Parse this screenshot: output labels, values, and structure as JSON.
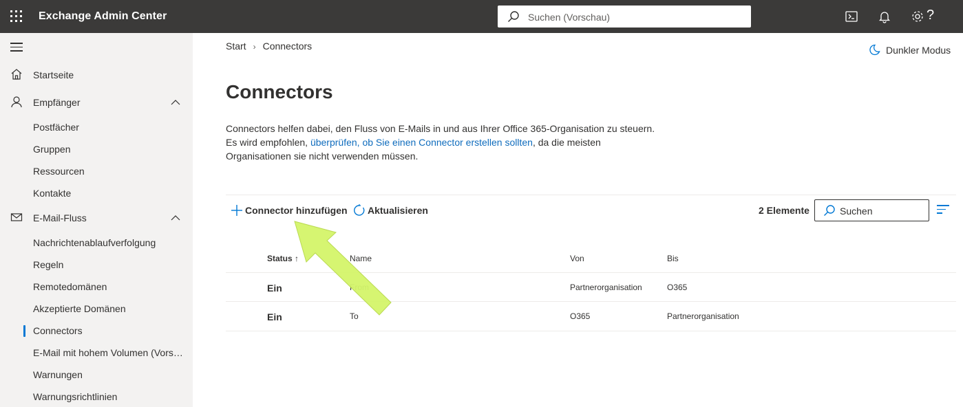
{
  "header": {
    "app_title": "Exchange Admin Center",
    "search_placeholder": "Suchen (Vorschau)",
    "help_label": "?"
  },
  "sidebar": {
    "items": [
      {
        "label": "Startseite",
        "icon": "home-icon"
      },
      {
        "label": "Empfänger",
        "icon": "person-icon",
        "expanded": true
      },
      {
        "label": "Postfächer"
      },
      {
        "label": "Gruppen"
      },
      {
        "label": "Ressourcen"
      },
      {
        "label": "Kontakte"
      },
      {
        "label": "E-Mail-Fluss",
        "icon": "mail-icon",
        "expanded": true
      },
      {
        "label": "Nachrichtenablaufverfolgung"
      },
      {
        "label": "Regeln"
      },
      {
        "label": "Remotedomänen"
      },
      {
        "label": "Akzeptierte Domänen"
      },
      {
        "label": "Connectors",
        "active": true
      },
      {
        "label": "E-Mail mit hohem Volumen (Vorschau)"
      },
      {
        "label": "Warnungen"
      },
      {
        "label": "Warnungsrichtlinien"
      }
    ]
  },
  "breadcrumb": {
    "home": "Start",
    "current": "Connectors"
  },
  "dark_mode_label": "Dunkler Modus",
  "page": {
    "title": "Connectors",
    "desc_line1": "Connectors helfen dabei, den Fluss von E-Mails in und aus Ihrer Office 365-Organisation zu steuern.",
    "desc_line2_pre": "Es wird empfohlen, ",
    "desc_link": "überprüfen, ob Sie einen Connector erstellen sollten",
    "desc_line2_post": ", da die meisten",
    "desc_line3": "Organisationen sie nicht verwenden müssen."
  },
  "toolbar": {
    "add_label": "Connector hinzufügen",
    "refresh_label": "Aktualisieren",
    "count_label": "2 Elemente",
    "search_placeholder": "Suchen"
  },
  "table": {
    "columns": {
      "status": "Status",
      "status_sort": "↑",
      "name": "Name",
      "from": "Von",
      "to": "Bis"
    },
    "rows": [
      {
        "status": "Ein",
        "name": "From",
        "from": "Partnerorganisation",
        "to": "O365"
      },
      {
        "status": "Ein",
        "name": "To",
        "from": "O365",
        "to": "Partnerorganisation"
      }
    ]
  },
  "colors": {
    "topbar": "#3b3a39",
    "sidebar": "#f3f2f1",
    "accent": "#0078d4",
    "link": "#0f6cbd",
    "annotation_arrow": "#d4f56a"
  }
}
